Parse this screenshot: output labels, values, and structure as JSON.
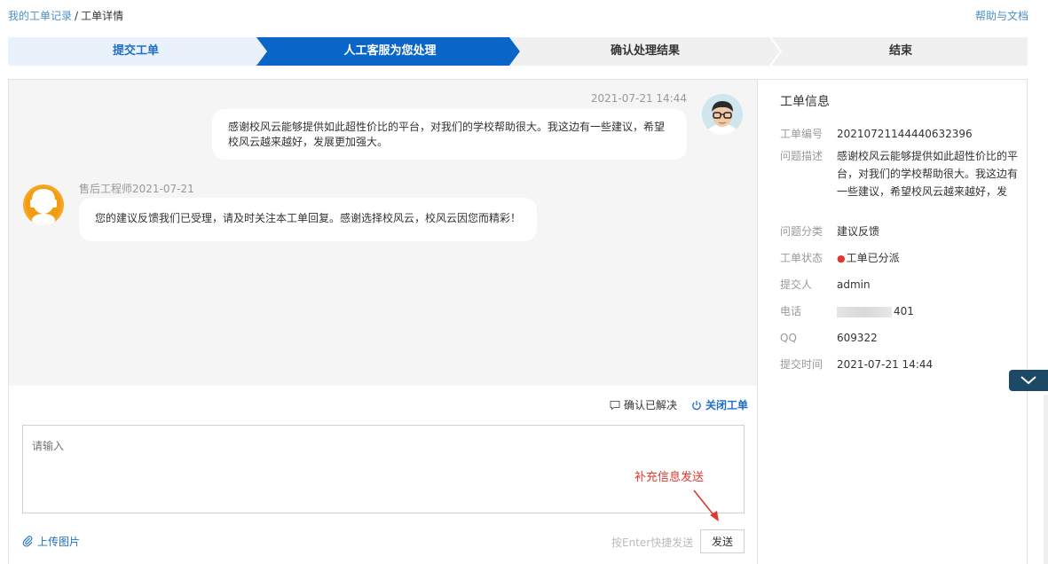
{
  "breadcrumb": {
    "parent": "我的工单记录",
    "separator": "/",
    "current": "工单详情"
  },
  "help_link": "帮助与文档",
  "steps": [
    {
      "label": "提交工单",
      "state": "done"
    },
    {
      "label": "人工客服为您处理",
      "state": "active"
    },
    {
      "label": "确认处理结果",
      "state": "pending"
    },
    {
      "label": "结束",
      "state": "pending"
    }
  ],
  "chat": {
    "messages": [
      {
        "sender": "user",
        "time": "2021-07-21 14:44",
        "text_line1": "感谢校风云能够提供如此超性价比的平台，对我们的学校帮助很大。我这边有一些建议，希望",
        "text_line2": "校风云越来越好，发展更加强大。"
      },
      {
        "sender": "engineer",
        "name_time": "售后工程师2021-07-21",
        "text": "您的建议反馈我们已受理，请及时关注本工单回复。感谢选择校风云，校风云因您而精彩！"
      }
    ]
  },
  "actions": {
    "confirm": "确认已解决",
    "close": "关闭工单"
  },
  "composer": {
    "placeholder": "请输入",
    "annotation": "补充信息发送",
    "upload": "上传图片",
    "enter_hint": "按Enter快捷发送",
    "send": "发送"
  },
  "info": {
    "title": "工单信息",
    "rows": [
      {
        "label": "工单编号",
        "value": "20210721144440632396"
      },
      {
        "label": "问题描述",
        "value": "感谢校风云能够提供如此超性价比的平台，对我们的学校帮助很大。我这边有一些建议，希望校风云越来越好，发"
      },
      {
        "label": "问题分类",
        "value": "建议反馈"
      },
      {
        "label": "工单状态",
        "value": "工单已分派"
      },
      {
        "label": "提交人",
        "value": "admin"
      },
      {
        "label": "电话",
        "value": "401"
      },
      {
        "label": "QQ",
        "value": "609322"
      },
      {
        "label": "提交时间",
        "value": "2021-07-21 14:44"
      }
    ]
  },
  "colors": {
    "active_step": "#0a65c8",
    "done_step": "#e9f1fa",
    "pending_step": "#f0f0f0",
    "link": "#1f6fc4",
    "status_dot": "#e0382f",
    "annotation": "#e0382f"
  }
}
